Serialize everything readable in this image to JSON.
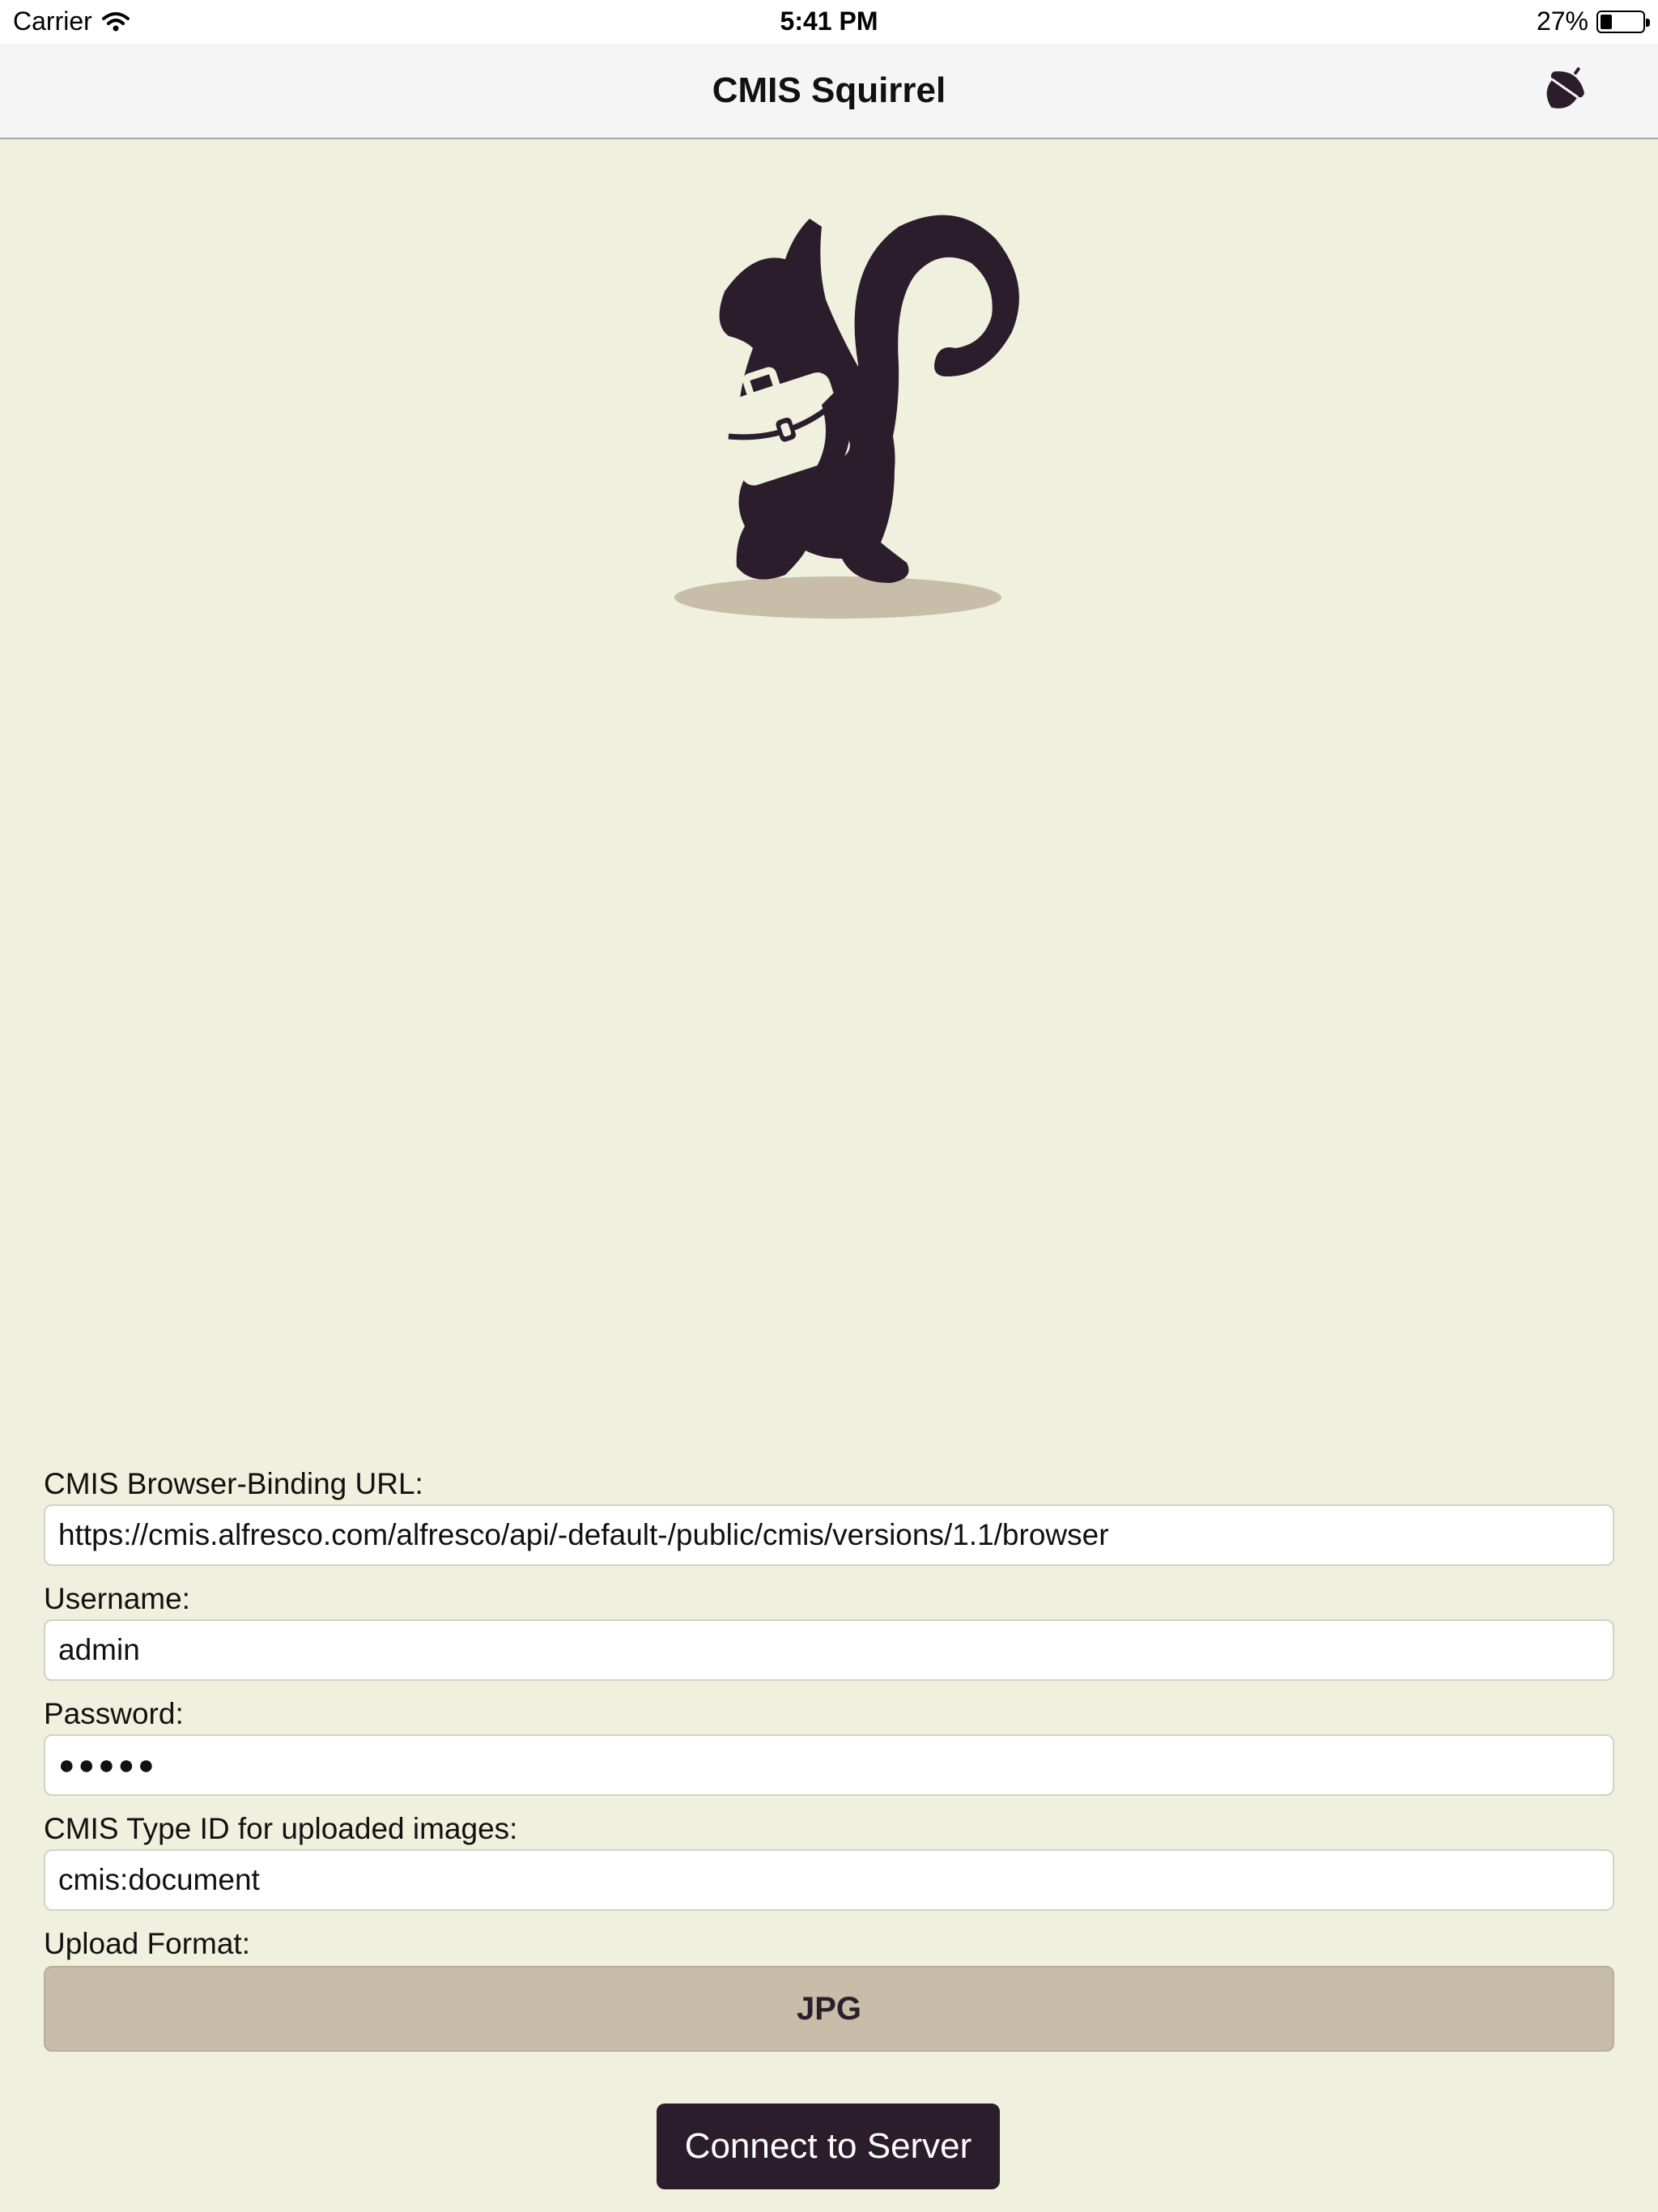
{
  "status_bar": {
    "carrier": "Carrier",
    "time": "5:41 PM",
    "battery": "27%",
    "battery_level": 0.27
  },
  "nav": {
    "title": "CMIS Squirrel",
    "action_icon": "acorn-icon"
  },
  "hero": {
    "icon": "squirrel-briefcase-logo"
  },
  "form": {
    "url_label": "CMIS Browser-Binding URL:",
    "url_value": "https://cmis.alfresco.com/alfresco/api/-default-/public/cmis/versions/1.1/browser",
    "username_label": "Username:",
    "username_value": "admin",
    "password_label": "Password:",
    "password_value": "●●●●●",
    "type_label": "CMIS Type ID for uploaded images:",
    "type_value": "cmis:document",
    "format_label": "Upload Format:",
    "format_value": "JPG"
  },
  "connect_label": "Connect to Server",
  "colors": {
    "background": "#F0F0DE",
    "brand_dark": "#2B1D2C",
    "format_button": "#C8BDA8",
    "shadow": "#C8BDA8"
  }
}
